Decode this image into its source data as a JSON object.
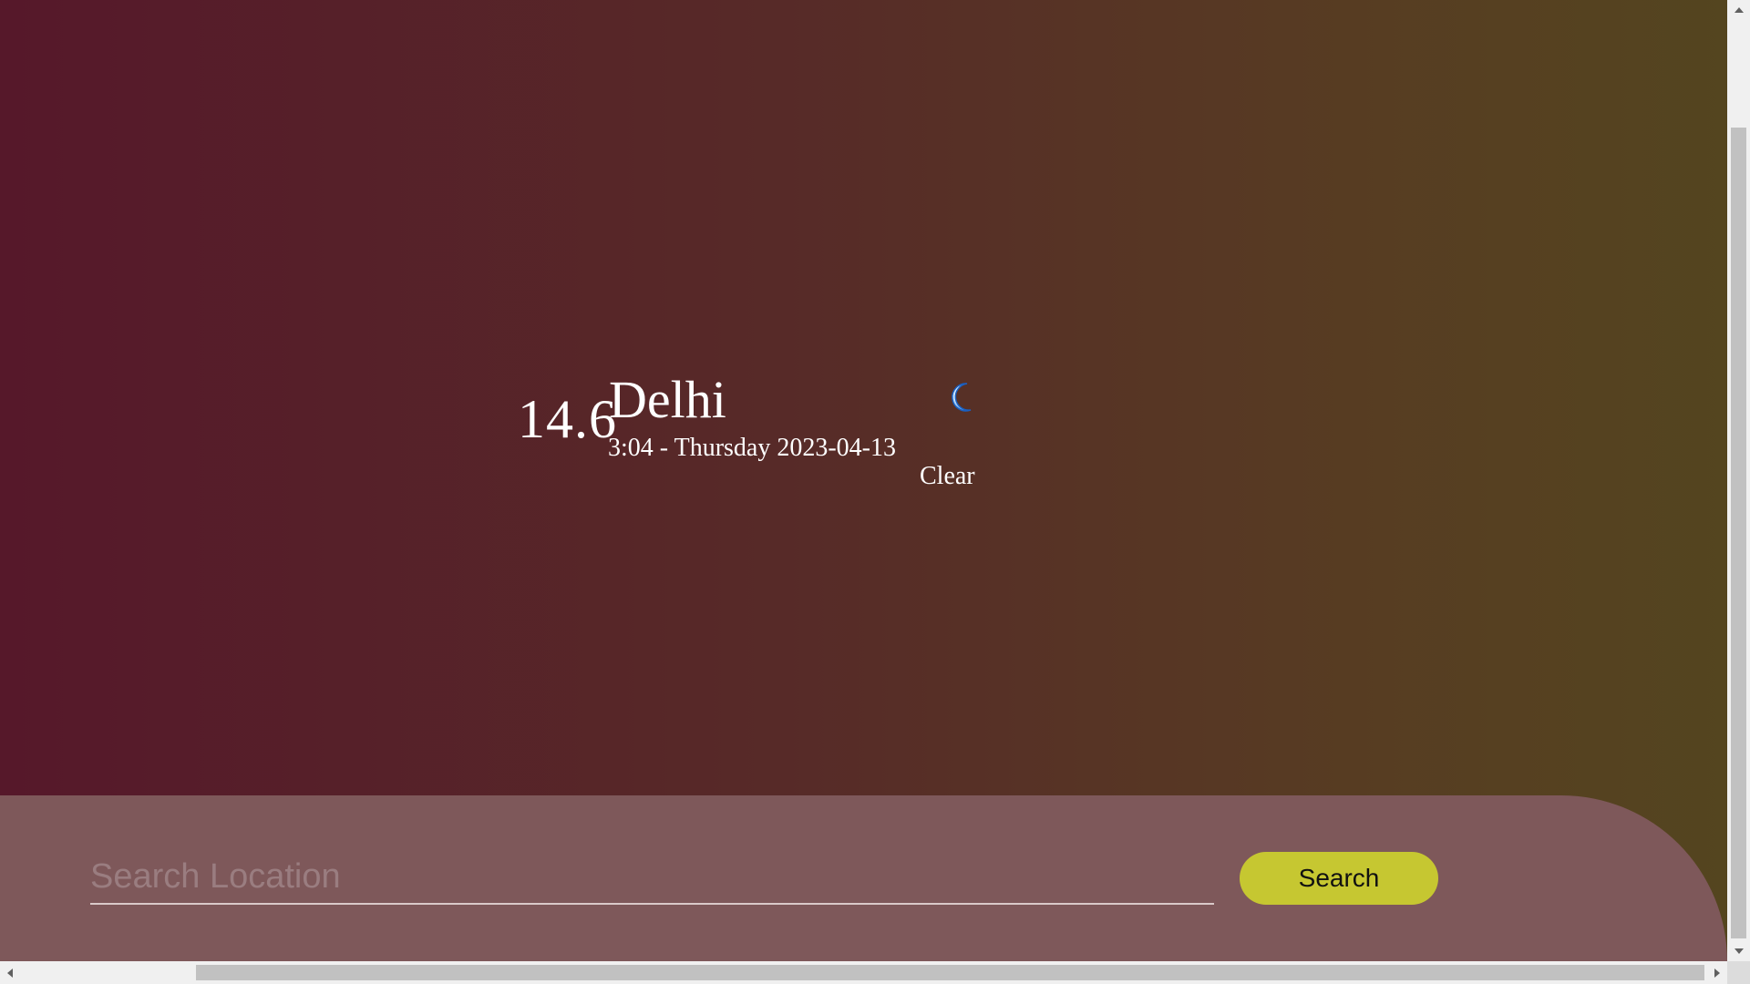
{
  "weather": {
    "temperature": "14.6",
    "city": "Delhi",
    "datetime": "3:04 - Thursday 2023-04-13",
    "condition": "Clear",
    "icon": "moon-icon"
  },
  "search": {
    "placeholder": "Search Location",
    "value": "",
    "button_label": "Search"
  },
  "colors": {
    "background_left": "#56182a",
    "background_right": "#54451f",
    "panel": "#7e585a",
    "button": "#c6c731",
    "moon": "#1e6fd9"
  }
}
